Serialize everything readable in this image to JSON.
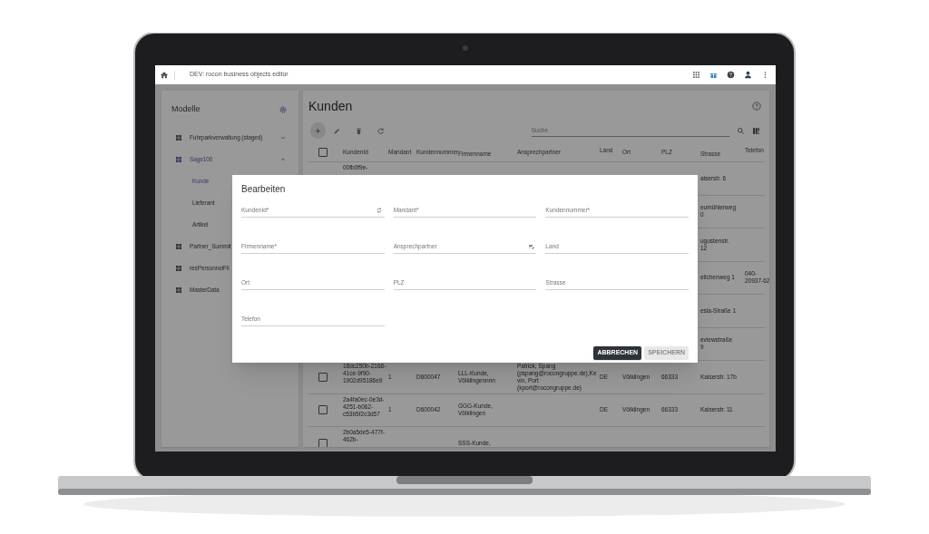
{
  "topbar": {
    "title": "DEV: rocon business objects editor"
  },
  "sidebar": {
    "title": "Modelle",
    "items": [
      {
        "label": "Fuhrparkverwaltung (staged)",
        "selected": false,
        "expanded": false
      },
      {
        "label": "Sage100",
        "selected": true,
        "expanded": true,
        "children": [
          {
            "label": "Kunde",
            "selected": true
          },
          {
            "label": "Lieferant",
            "selected": false
          },
          {
            "label": "Artikel",
            "selected": false
          }
        ]
      },
      {
        "label": "Partner_Summit",
        "selected": false
      },
      {
        "label": "resPersonnelFil",
        "selected": false
      },
      {
        "label": "MasterData",
        "selected": false
      }
    ]
  },
  "main": {
    "title": "Kunden",
    "search": {
      "placeholder": "Suche"
    },
    "table": {
      "select_all": {
        "checked": false
      },
      "columns": [
        "KundenId",
        "Mandant",
        "Kundennummer",
        "Firmenname",
        "Ansprechpartner",
        "Land",
        "Ort",
        "PLZ",
        "Strasse",
        "Telefon"
      ],
      "rows": [
        {
          "cells": [
            "00fb0f9e-",
            null,
            null,
            null,
            null,
            null,
            null,
            null,
            "aiserstr. 6",
            null
          ]
        },
        {
          "cells": [
            null,
            null,
            null,
            null,
            null,
            null,
            null,
            null,
            "eumühlerweg\n0",
            null
          ]
        },
        {
          "cells": [
            null,
            null,
            null,
            null,
            null,
            null,
            null,
            null,
            "ugustenstr.\n12",
            null
          ]
        },
        {
          "cells": [
            null,
            null,
            null,
            null,
            null,
            null,
            null,
            null,
            "eilchenweg 1",
            "040-20937-62"
          ]
        },
        {
          "cells": [
            null,
            null,
            null,
            null,
            null,
            null,
            null,
            null,
            "esla-Straße 1",
            null
          ]
        },
        {
          "cells": [
            null,
            null,
            null,
            null,
            null,
            null,
            null,
            null,
            "eviewstraße\n9",
            null
          ]
        },
        {
          "checked": false,
          "cells": [
            "18dc250b-2168-41ce-9f90-1902d95186e9",
            "1",
            "D600047",
            "LLL-Kunde, Völklingennnn",
            "Patrick, Spang (pspang@rocongruppe.de),Kevin, Port (kport@rocongruppe.de)",
            "DE",
            "Völklingen",
            "66333",
            "Kaiserstr. 17b",
            null
          ]
        },
        {
          "checked": false,
          "cells": [
            "2a4fa0ec-0e3d-4251-b062-c53b5f2c3d57",
            "1",
            "D600042",
            "GGG-Kunde, Völklingen",
            null,
            "DE",
            "Völklingen",
            "66333",
            "Kaiserstr. 11",
            null
          ]
        },
        {
          "checked": false,
          "cells": [
            "2b0a5de5-477f-462b-",
            null,
            null,
            "SSS-Kunde,",
            null,
            null,
            null,
            null,
            null,
            null
          ]
        }
      ]
    }
  },
  "dialog": {
    "title": "Bearbeiten",
    "fields": [
      {
        "label": "KundenId*",
        "kind": "generate"
      },
      {
        "label": "Mandant*",
        "kind": "plain"
      },
      {
        "label": "Kundennummer*",
        "kind": "plain"
      },
      {
        "label": "Firmenname*",
        "kind": "plain"
      },
      {
        "label": "Ansprechpartner",
        "kind": "picker"
      },
      {
        "label": "Land",
        "kind": "plain"
      },
      {
        "label": "Ort",
        "kind": "plain"
      },
      {
        "label": "PLZ",
        "kind": "plain"
      },
      {
        "label": "Strasse",
        "kind": "plain"
      },
      {
        "label": "Telefon",
        "kind": "plain"
      }
    ],
    "buttons": [
      {
        "label": "ABBRECHEN",
        "disabled": false
      },
      {
        "label": "SPEICHERN",
        "disabled": true
      }
    ]
  }
}
